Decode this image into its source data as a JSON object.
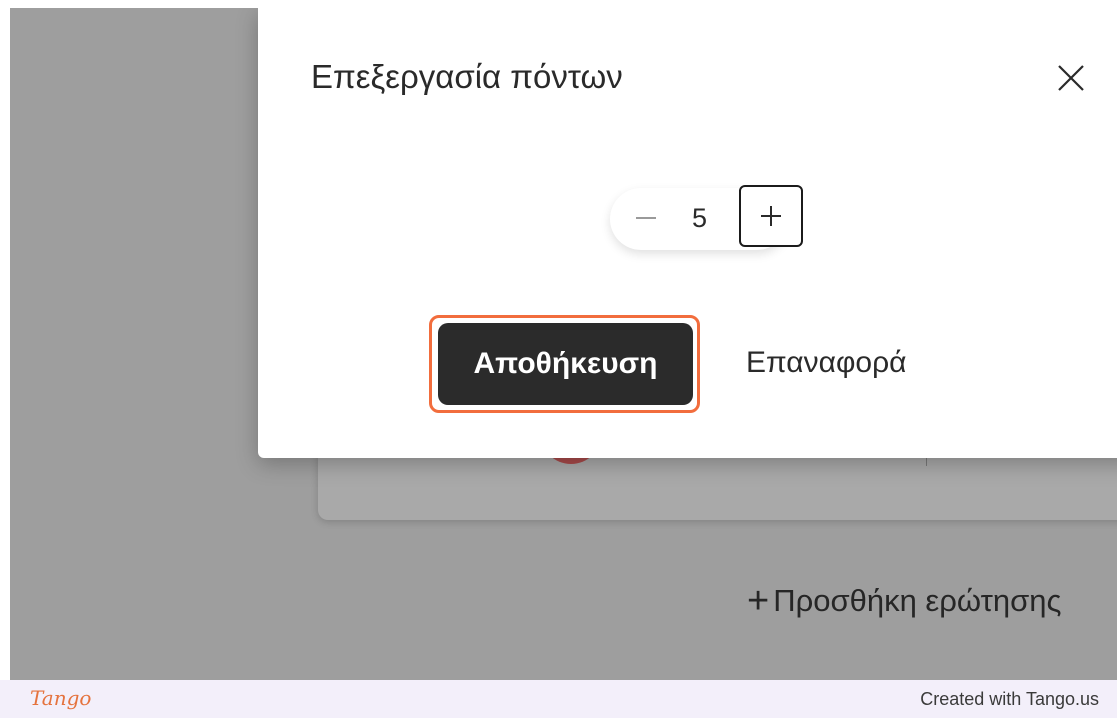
{
  "dialog": {
    "title": "Επεξεργασία πόντων",
    "close_icon": "close-icon",
    "stepper": {
      "value": "5",
      "minus_icon": "minus-icon",
      "plus_icon": "plus-icon"
    },
    "save_label": "Αποθήκευση",
    "reset_label": "Επαναφορά"
  },
  "background": {
    "add_question_label": "Προσθήκη ερώτησης",
    "add_icon": "plus-icon"
  },
  "footer": {
    "logo": "Tango",
    "credit": "Created with Tango.us"
  },
  "colors": {
    "highlight": "#f26d3d",
    "primary_button": "#2b2b2b",
    "overlay": "#9e9e9e",
    "brand": "#e5733e"
  }
}
